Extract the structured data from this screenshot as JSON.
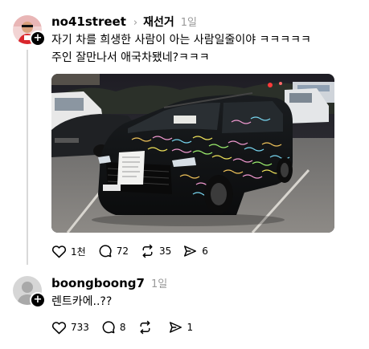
{
  "post": {
    "username": "no41street",
    "chevron": "›",
    "topic": "재선거",
    "time": "1일",
    "text_lines": [
      "자기 차를 희생한 사람이 아는 사람일줄이야 ㅋㅋㅋㅋㅋ",
      "주인 잘만나서 애국차됐네?ㅋㅋㅋ"
    ],
    "image_icon": "car-photo",
    "actions": {
      "like": {
        "icon": "heart-icon",
        "count": "1천"
      },
      "comment": {
        "icon": "comment-icon",
        "count": "72"
      },
      "repost": {
        "icon": "repost-icon",
        "count": "35"
      },
      "share": {
        "icon": "send-icon",
        "count": "6"
      }
    }
  },
  "reply": {
    "username": "boongboong7",
    "time": "1일",
    "text": "렌트카에..??",
    "actions": {
      "like": {
        "icon": "heart-icon",
        "count": "733"
      },
      "comment": {
        "icon": "comment-icon",
        "count": "8"
      },
      "repost": {
        "icon": "repost-icon",
        "count": ""
      },
      "share": {
        "icon": "send-icon",
        "count": "1"
      }
    }
  },
  "colors": {
    "text": "#000000",
    "muted": "#999999",
    "thread_line": "#d9d9d9",
    "badge": "#000000",
    "avatar_red": "#d9262c"
  }
}
